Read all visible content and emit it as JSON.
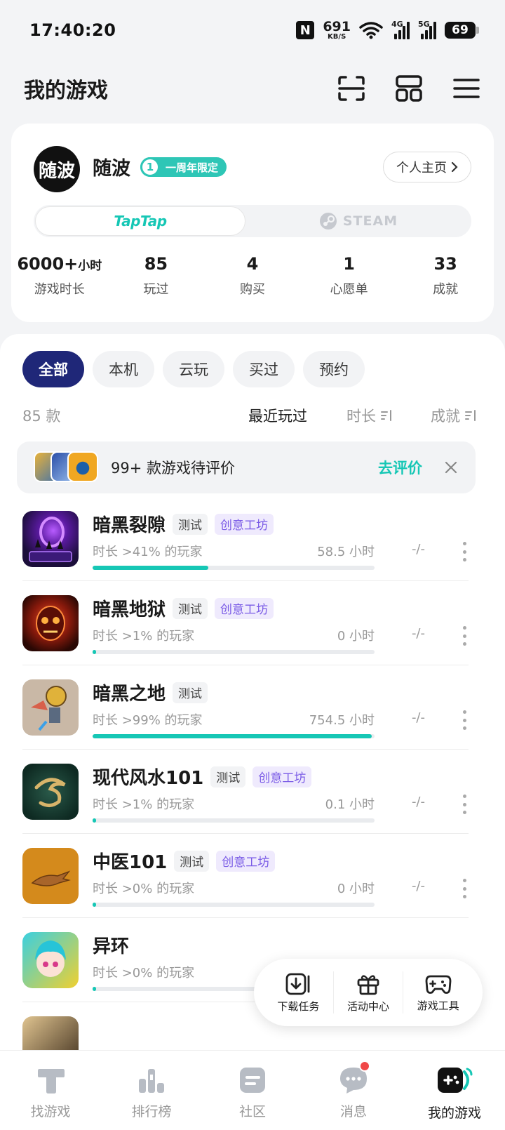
{
  "status_bar": {
    "time": "17:40:20",
    "net_speed": "691",
    "net_unit": "KB/S",
    "gen1": "4G",
    "gen2": "5G",
    "battery": "69"
  },
  "header": {
    "title": "我的游戏"
  },
  "profile": {
    "avatar_text": "随波",
    "username": "随波",
    "badge_num": "1",
    "badge_text": "一周年限定",
    "link_label": "个人主页",
    "platforms": {
      "taptap": "TapTap",
      "steam": "STEAM"
    },
    "stats": [
      {
        "value": "6000+",
        "unit": "小时",
        "label": "游戏时长"
      },
      {
        "value": "85",
        "unit": "",
        "label": "玩过"
      },
      {
        "value": "4",
        "unit": "",
        "label": "购买"
      },
      {
        "value": "1",
        "unit": "",
        "label": "心愿单"
      },
      {
        "value": "33",
        "unit": "",
        "label": "成就"
      }
    ]
  },
  "filters": [
    "全部",
    "本机",
    "云玩",
    "买过",
    "预约"
  ],
  "sort": {
    "count": "85 款",
    "recent": "最近玩过",
    "time": "时长",
    "achievements": "成就"
  },
  "review_banner": {
    "text": "99+ 款游戏待评价",
    "action": "去评价"
  },
  "games": [
    {
      "name": "暗黑裂隙",
      "tags": [
        "测试",
        "创意工坊"
      ],
      "percentile": "时长 >41% 的玩家",
      "hours": "58.5 小时",
      "progress": 0.41,
      "achievement": "-/-"
    },
    {
      "name": "暗黑地狱",
      "tags": [
        "测试",
        "创意工坊"
      ],
      "percentile": "时长 >1% 的玩家",
      "hours": "0 小时",
      "progress": 0.01,
      "achievement": "-/-"
    },
    {
      "name": "暗黑之地",
      "tags": [
        "测试"
      ],
      "percentile": "时长 >99% 的玩家",
      "hours": "754.5 小时",
      "progress": 0.99,
      "achievement": "-/-"
    },
    {
      "name": "现代风水101",
      "tags": [
        "测试",
        "创意工坊"
      ],
      "percentile": "时长 >1% 的玩家",
      "hours": "0.1 小时",
      "progress": 0.01,
      "achievement": "-/-"
    },
    {
      "name": "中医101",
      "tags": [
        "测试",
        "创意工坊"
      ],
      "percentile": "时长 >0% 的玩家",
      "hours": "0 小时",
      "progress": 0.0,
      "achievement": "-/-"
    },
    {
      "name": "异环",
      "tags": [],
      "percentile": "时长 >0% 的玩家",
      "hours": "",
      "progress": 0.0,
      "achievement": ""
    }
  ],
  "float_tools": [
    "下载任务",
    "活动中心",
    "游戏工具"
  ],
  "bottom_nav": [
    {
      "label": "找游戏",
      "icon": "find-games-icon"
    },
    {
      "label": "排行榜",
      "icon": "ranking-icon"
    },
    {
      "label": "社区",
      "icon": "community-icon"
    },
    {
      "label": "消息",
      "icon": "message-icon"
    },
    {
      "label": "我的游戏",
      "icon": "my-games-icon"
    }
  ],
  "colors": {
    "accent": "#16c7b5",
    "chip_active": "#1f2778",
    "workshop": "#7a5be6",
    "badge": "#2ec6b6",
    "notify": "#f04848"
  }
}
